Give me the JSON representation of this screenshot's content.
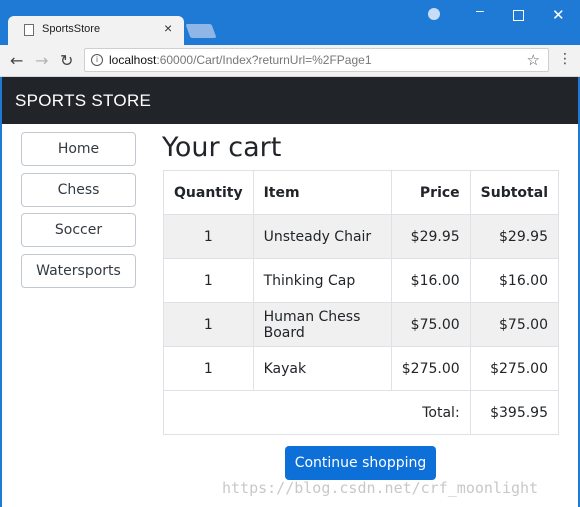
{
  "browser": {
    "tab_title": "SportsStore",
    "tab_close": "×",
    "url_host": "localhost",
    "url_rest": ":60000/Cart/Index?returnUrl=%2FPage1",
    "nav_back": "←",
    "nav_forward": "→",
    "nav_reload": "↻",
    "star": "☆",
    "menu": "⋮",
    "win_min": "–",
    "win_close": "✕",
    "info": "i"
  },
  "navbar": {
    "brand": "SPORTS STORE"
  },
  "categories": [
    "Home",
    "Chess",
    "Soccer",
    "Watersports"
  ],
  "page": {
    "heading": "Your cart"
  },
  "cart": {
    "columns": [
      "Quantity",
      "Item",
      "Price",
      "Subtotal"
    ],
    "rows": [
      {
        "quantity": "1",
        "item": "Unsteady Chair",
        "price": "$29.95",
        "subtotal": "$29.95"
      },
      {
        "quantity": "1",
        "item": "Thinking Cap",
        "price": "$16.00",
        "subtotal": "$16.00"
      },
      {
        "quantity": "1",
        "item": "Human Chess Board",
        "price": "$75.00",
        "subtotal": "$75.00"
      },
      {
        "quantity": "1",
        "item": "Kayak",
        "price": "$275.00",
        "subtotal": "$275.00"
      }
    ],
    "total_label": "Total:",
    "total_value": "$395.95"
  },
  "actions": {
    "continue_label": "Continue shopping"
  },
  "watermark": "https://blog.csdn.net/crf_moonlight",
  "colors": {
    "navbar": "#212529",
    "primary": "#0d6fd8",
    "titlebar": "#1f7ad6"
  }
}
